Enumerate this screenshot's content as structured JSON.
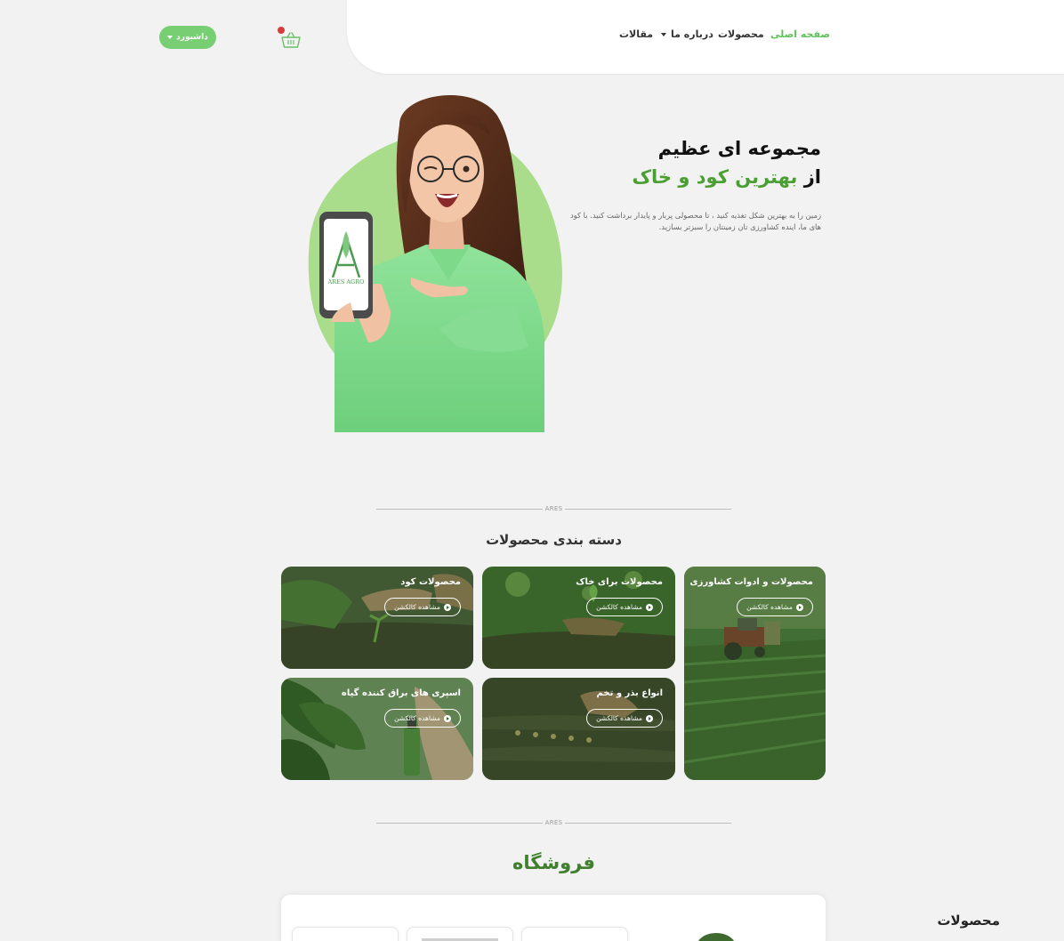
{
  "nav": {
    "links": [
      "صفحه اصلی",
      "محصولات",
      "درباره ما",
      "مقالات"
    ],
    "dashboard_label": "داشبورد",
    "cart_badge_color": "#d43b3b"
  },
  "hero": {
    "title_line1": "مجموعه ای عظیم",
    "title_prefix": "از",
    "title_highlight": "بهترین کود و خاک",
    "description": "زمین را به بهترین شکل تغذیه کنید ، تا محصولی پربار و پایدار برداشت کنید. با کود های ما، اینده کشاورزی تان زمینتان را سبزتر بسازید.",
    "phone_brand": "ARES AGRO"
  },
  "categories": {
    "divider_label": "ARES",
    "title": "دسته بندی محصولات",
    "button_label": "مشاهده کالکشن",
    "items": [
      {
        "title": "محصولات و ادوات کشاورزی"
      },
      {
        "title": "محصولات برای خاک"
      },
      {
        "title": "محصولات کود"
      },
      {
        "title": "انواع بذر و تخم"
      },
      {
        "title": "اسپری های براق کننده گیاه"
      }
    ]
  },
  "shop": {
    "divider_label": "ARES",
    "title": "فروشگاه",
    "panel_title": "محصولات"
  },
  "colors": {
    "accent": "#78cf73",
    "dark_green": "#3f7f2e",
    "hero_green": "#4a9f32"
  }
}
